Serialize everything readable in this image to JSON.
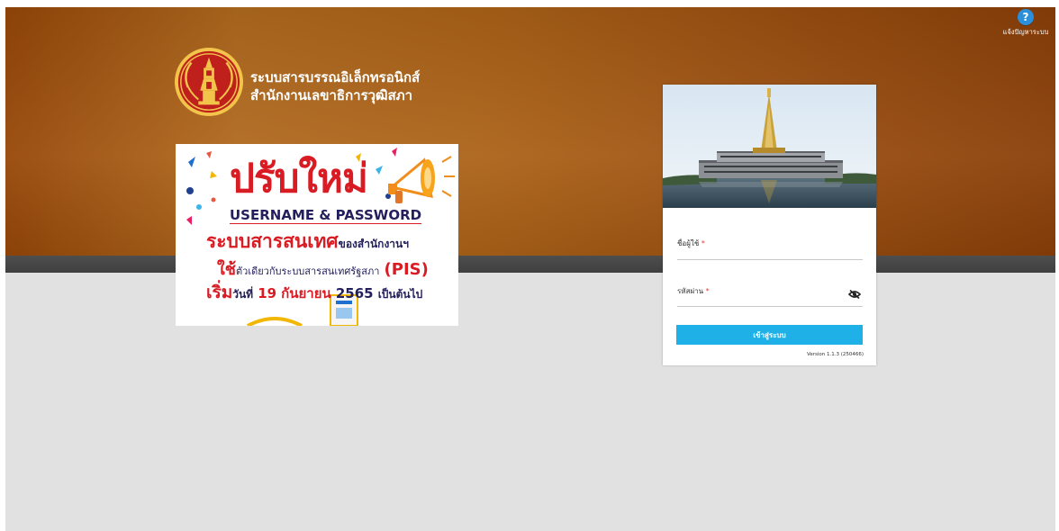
{
  "help": {
    "icon": "help-bubble-icon",
    "label": "แจ้งปัญหาระบบ"
  },
  "org": {
    "line1": "ระบบสารบรรณอิเล็กทรอนิกส์",
    "line2": "สำนักงานเลขาธิการวุฒิสภา",
    "logo": "senate-seal-logo"
  },
  "announcement": {
    "title": "ปรับใหม่",
    "subtitle": "USERNAME & PASSWORD",
    "line3_big": "ระบบสารสนเทศ",
    "line3_small": "ของสำนักงานฯ",
    "line4_big": "ใช้",
    "line4_small": "ตัวเดียวกับระบบสารสนเทศรัฐสภา",
    "line4_pis": "(PIS)",
    "line5_big": "เริ่ม",
    "line5_small": "วันที่",
    "line5_day": "19",
    "line5_month": "กันยายน",
    "line5_year": "2565",
    "line5_tail": "เป็นต้นไป"
  },
  "login": {
    "username_label": "ชื่อผู้ใช้",
    "password_label": "รหัสผ่าน",
    "required_mark": "*",
    "username_value": "",
    "password_value": "",
    "toggle_icon": "eye-slash-icon",
    "submit_label": "เข้าสู่ระบบ",
    "version": "Version 1.1.3 (250466)"
  },
  "colors": {
    "banner": "#a85e18",
    "stripe": "#474747",
    "background": "#e1e1e1",
    "button": "#1fb0e8",
    "required": "#e53935"
  }
}
